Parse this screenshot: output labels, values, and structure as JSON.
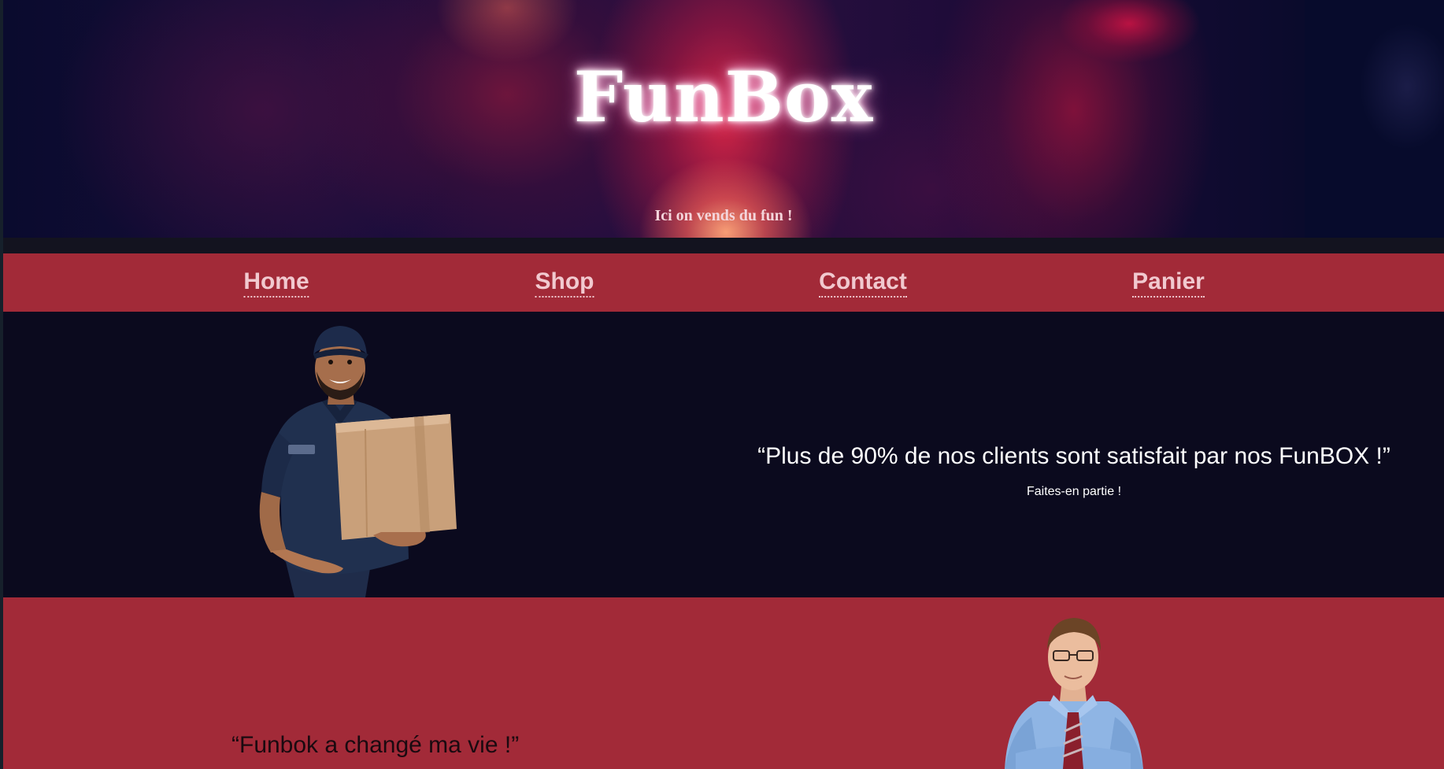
{
  "hero": {
    "title": "FunBox",
    "subtitle": "Ici on vends du fun !"
  },
  "nav": {
    "items": [
      {
        "label": "Home"
      },
      {
        "label": "Shop"
      },
      {
        "label": "Contact"
      },
      {
        "label": "Panier"
      }
    ]
  },
  "promo": {
    "quote": "“Plus de 90% de nos clients sont satisfait par nos FunBOX !”",
    "subtext": "Faites-en partie !"
  },
  "testimonial": {
    "quote": "“Funbok a changé ma vie !”"
  },
  "colors": {
    "nav_background": "#a22a38",
    "page_background": "#0b0a1e",
    "nav_text": "#f1c9cf"
  }
}
